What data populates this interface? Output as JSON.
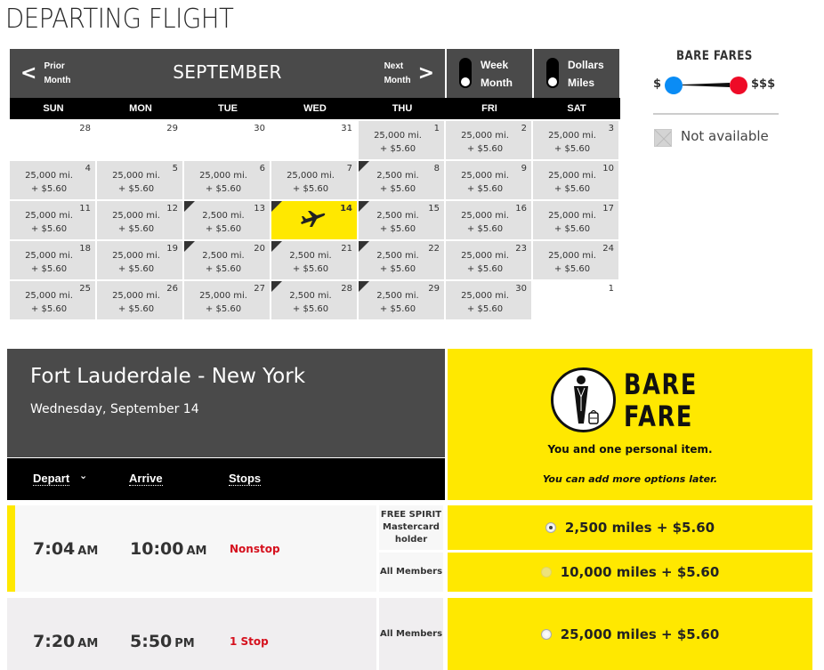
{
  "page": {
    "title": "DEPARTING FLIGHT"
  },
  "calendar": {
    "month": "SEPTEMBER",
    "prev": {
      "line1": "Prior",
      "line2": "Month"
    },
    "next": {
      "line1": "Next",
      "line2": "Month"
    },
    "view_toggle": {
      "top": "Week",
      "bottom": "Month",
      "selected": "Month"
    },
    "currency_toggle": {
      "top": "Dollars",
      "bottom": "Miles",
      "selected": "Miles"
    },
    "days_of_week": [
      "SUN",
      "MON",
      "TUE",
      "WED",
      "THU",
      "FRI",
      "SAT"
    ],
    "cells": [
      {
        "day": "28",
        "empty": true
      },
      {
        "day": "29",
        "empty": true
      },
      {
        "day": "30",
        "empty": true
      },
      {
        "day": "31",
        "empty": true
      },
      {
        "day": "1",
        "miles": "25,000 mi.",
        "fee": "+ $5.60"
      },
      {
        "day": "2",
        "miles": "25,000 mi.",
        "fee": "+ $5.60"
      },
      {
        "day": "3",
        "miles": "25,000 mi.",
        "fee": "+ $5.60"
      },
      {
        "day": "4",
        "miles": "25,000 mi.",
        "fee": "+ $5.60"
      },
      {
        "day": "5",
        "miles": "25,000 mi.",
        "fee": "+ $5.60"
      },
      {
        "day": "6",
        "miles": "25,000 mi.",
        "fee": "+ $5.60"
      },
      {
        "day": "7",
        "miles": "25,000 mi.",
        "fee": "+ $5.60"
      },
      {
        "day": "8",
        "miles": "2,500 mi.",
        "fee": "+ $5.60",
        "low": true
      },
      {
        "day": "9",
        "miles": "25,000 mi.",
        "fee": "+ $5.60"
      },
      {
        "day": "10",
        "miles": "25,000 mi.",
        "fee": "+ $5.60"
      },
      {
        "day": "11",
        "miles": "25,000 mi.",
        "fee": "+ $5.60"
      },
      {
        "day": "12",
        "miles": "25,000 mi.",
        "fee": "+ $5.60"
      },
      {
        "day": "13",
        "miles": "2,500 mi.",
        "fee": "+ $5.60",
        "low": true
      },
      {
        "day": "14",
        "selected": true,
        "low": true
      },
      {
        "day": "15",
        "miles": "2,500 mi.",
        "fee": "+ $5.60",
        "low": true
      },
      {
        "day": "16",
        "miles": "25,000 mi.",
        "fee": "+ $5.60"
      },
      {
        "day": "17",
        "miles": "25,000 mi.",
        "fee": "+ $5.60"
      },
      {
        "day": "18",
        "miles": "25,000 mi.",
        "fee": "+ $5.60"
      },
      {
        "day": "19",
        "miles": "25,000 mi.",
        "fee": "+ $5.60"
      },
      {
        "day": "20",
        "miles": "2,500 mi.",
        "fee": "+ $5.60",
        "low": true
      },
      {
        "day": "21",
        "miles": "2,500 mi.",
        "fee": "+ $5.60",
        "low": true
      },
      {
        "day": "22",
        "miles": "2,500 mi.",
        "fee": "+ $5.60",
        "low": true
      },
      {
        "day": "23",
        "miles": "25,000 mi.",
        "fee": "+ $5.60"
      },
      {
        "day": "24",
        "miles": "25,000 mi.",
        "fee": "+ $5.60"
      },
      {
        "day": "25",
        "miles": "25,000 mi.",
        "fee": "+ $5.60"
      },
      {
        "day": "26",
        "miles": "25,000 mi.",
        "fee": "+ $5.60"
      },
      {
        "day": "27",
        "miles": "25,000 mi.",
        "fee": "+ $5.60"
      },
      {
        "day": "28",
        "miles": "2,500 mi.",
        "fee": "+ $5.60",
        "low": true
      },
      {
        "day": "29",
        "miles": "2,500 mi.",
        "fee": "+ $5.60",
        "low": true
      },
      {
        "day": "30",
        "miles": "25,000 mi.",
        "fee": "+ $5.60"
      },
      {
        "day": "1",
        "empty": true
      }
    ]
  },
  "legend": {
    "title": "BARE FARES",
    "low": "$",
    "high": "$$$",
    "low_color": "#0a8cf5",
    "high_color": "#ee0b27",
    "not_available": "Not available"
  },
  "route": {
    "title": "Fort Lauderdale - New York",
    "date": "Wednesday, September 14",
    "sort": {
      "depart": "Depart",
      "arrive": "Arrive",
      "stops": "Stops"
    }
  },
  "bare_fare": {
    "line1": "BARE",
    "line2": "FARE",
    "description": "You and one personal item.",
    "note": "You can add more options later.",
    "accent": "#ffe800"
  },
  "flights": [
    {
      "depart": "7:04",
      "depart_ampm": "AM",
      "arrive": "10:00",
      "arrive_ampm": "AM",
      "stops": "Nonstop",
      "fares": [
        {
          "member": "FREE SPIRIT Mastercard holder",
          "price": "2,500 miles + $5.60",
          "checked": true
        },
        {
          "member": "All Members",
          "price": "10,000 miles + $5.60",
          "disabled": true
        }
      ]
    },
    {
      "depart": "7:20",
      "depart_ampm": "AM",
      "arrive": "5:50",
      "arrive_ampm": "PM",
      "stops": "1 Stop",
      "fares": [
        {
          "member": "All Members",
          "price": "25,000 miles + $5.60"
        }
      ]
    }
  ]
}
